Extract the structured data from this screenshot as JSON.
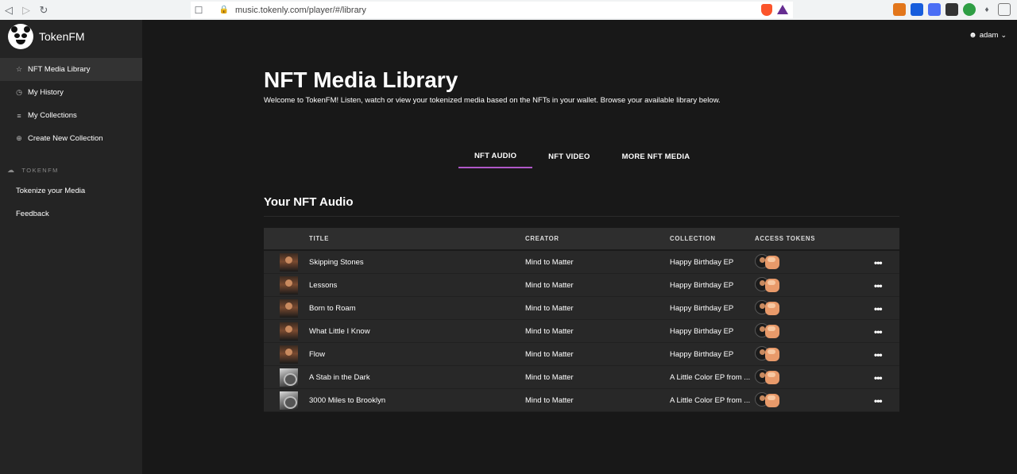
{
  "browser": {
    "url": "music.tokenly.com/player/#/library",
    "back_icon": "back-arrow-icon",
    "forward_icon": "forward-arrow-icon",
    "reload_icon": "reload-icon"
  },
  "sidebar": {
    "brand": "TokenFM",
    "items": [
      {
        "label": "NFT Media Library",
        "icon": "star-icon",
        "active": true
      },
      {
        "label": "My History",
        "icon": "clock-icon",
        "active": false
      },
      {
        "label": "My Collections",
        "icon": "list-icon",
        "active": false
      },
      {
        "label": "Create New Collection",
        "icon": "plus-circle-icon",
        "active": false
      }
    ],
    "section_label": "TOKENFM",
    "links": [
      "Tokenize your Media",
      "Feedback"
    ]
  },
  "user": {
    "name": "adam"
  },
  "main": {
    "title": "NFT Media Library",
    "subtitle": "Welcome to TokenFM! Listen, watch or view your tokenized media based on the NFTs in your wallet. Browse your available library below.",
    "tabs": [
      {
        "label": "NFT AUDIO",
        "active": true
      },
      {
        "label": "NFT VIDEO",
        "active": false
      },
      {
        "label": "MORE NFT MEDIA",
        "active": false
      }
    ],
    "section_title": "Your NFT Audio",
    "table": {
      "headers": {
        "title": "TITLE",
        "creator": "CREATOR",
        "collection": "COLLECTION",
        "tokens": "ACCESS TOKENS"
      },
      "rows": [
        {
          "title": "Skipping Stones",
          "creator": "Mind to Matter",
          "collection": "Happy Birthday EP"
        },
        {
          "title": "Lessons",
          "creator": "Mind to Matter",
          "collection": "Happy Birthday EP"
        },
        {
          "title": "Born to Roam",
          "creator": "Mind to Matter",
          "collection": "Happy Birthday EP"
        },
        {
          "title": "What Little I Know",
          "creator": "Mind to Matter",
          "collection": "Happy Birthday EP"
        },
        {
          "title": "Flow",
          "creator": "Mind to Matter",
          "collection": "Happy Birthday EP"
        },
        {
          "title": "A Stab in the Dark",
          "creator": "Mind to Matter",
          "collection": "A Little Color EP from ..."
        },
        {
          "title": "3000 Miles to Brooklyn",
          "creator": "Mind to Matter",
          "collection": "A Little Color EP from ..."
        }
      ]
    }
  },
  "colors": {
    "accent": "#b058c9",
    "sidebar_bg": "#242424",
    "page_bg": "#181818"
  }
}
